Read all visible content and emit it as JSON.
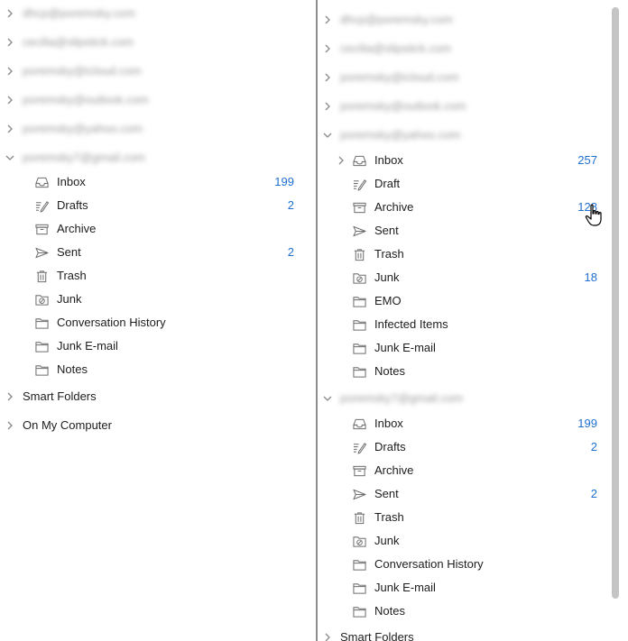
{
  "left": {
    "accounts": [
      {
        "label": "dhcp@poremsky.com",
        "expanded": false
      },
      {
        "label": "cecilia@slipstick.com",
        "expanded": false
      },
      {
        "label": "poremsky@icloud.com",
        "expanded": false
      },
      {
        "label": "poremsky@outlook.com",
        "expanded": false
      },
      {
        "label": "poremsky@yahoo.com",
        "expanded": false
      },
      {
        "label": "poremsky7@gmail.com",
        "expanded": true
      }
    ],
    "folders": [
      {
        "name": "Inbox",
        "icon": "inbox-icon",
        "count": "199"
      },
      {
        "name": "Drafts",
        "icon": "drafts-icon",
        "count": "2"
      },
      {
        "name": "Archive",
        "icon": "archive-icon",
        "count": ""
      },
      {
        "name": "Sent",
        "icon": "sent-icon",
        "count": "2"
      },
      {
        "name": "Trash",
        "icon": "trash-icon",
        "count": ""
      },
      {
        "name": "Junk",
        "icon": "junk-icon",
        "count": ""
      },
      {
        "name": "Conversation History",
        "icon": "folder-icon",
        "count": ""
      },
      {
        "name": "Junk E-mail",
        "icon": "folder-icon",
        "count": ""
      },
      {
        "name": "Notes",
        "icon": "folder-icon",
        "count": ""
      }
    ],
    "sections": [
      {
        "label": "Smart Folders"
      },
      {
        "label": "On My Computer"
      }
    ]
  },
  "right": {
    "accounts": [
      {
        "label": "dhcp@poremsky.com",
        "expanded": false
      },
      {
        "label": "cecilia@slipstick.com",
        "expanded": false
      },
      {
        "label": "poremsky@icloud.com",
        "expanded": false
      },
      {
        "label": "poremsky@outlook.com",
        "expanded": false
      }
    ],
    "yahoo_account": {
      "label": "poremsky@yahoo.com",
      "expanded": true
    },
    "yahoo_folders": [
      {
        "name": "Inbox",
        "icon": "inbox-icon",
        "count": "257",
        "has_children": true
      },
      {
        "name": "Draft",
        "icon": "drafts-icon",
        "count": ""
      },
      {
        "name": "Archive",
        "icon": "archive-icon",
        "count": "128"
      },
      {
        "name": "Sent",
        "icon": "sent-icon",
        "count": ""
      },
      {
        "name": "Trash",
        "icon": "trash-icon",
        "count": ""
      },
      {
        "name": "Junk",
        "icon": "junk-icon",
        "count": "18"
      },
      {
        "name": "EMO",
        "icon": "folder-icon",
        "count": ""
      },
      {
        "name": "Infected Items",
        "icon": "folder-icon",
        "count": ""
      },
      {
        "name": "Junk E-mail",
        "icon": "folder-icon",
        "count": ""
      },
      {
        "name": "Notes",
        "icon": "folder-icon",
        "count": ""
      }
    ],
    "gmail_account": {
      "label": "poremsky7@gmail.com",
      "expanded": true
    },
    "gmail_folders": [
      {
        "name": "Inbox",
        "icon": "inbox-icon",
        "count": "199"
      },
      {
        "name": "Drafts",
        "icon": "drafts-icon",
        "count": "2"
      },
      {
        "name": "Archive",
        "icon": "archive-icon",
        "count": ""
      },
      {
        "name": "Sent",
        "icon": "sent-icon",
        "count": "2"
      },
      {
        "name": "Trash",
        "icon": "trash-icon",
        "count": ""
      },
      {
        "name": "Junk",
        "icon": "junk-icon",
        "count": ""
      },
      {
        "name": "Conversation History",
        "icon": "folder-icon",
        "count": ""
      },
      {
        "name": "Junk E-mail",
        "icon": "folder-icon",
        "count": ""
      },
      {
        "name": "Notes",
        "icon": "folder-icon",
        "count": ""
      }
    ],
    "sections": [
      {
        "label": "Smart Folders"
      }
    ]
  },
  "colors": {
    "count_blue": "#1f6fd1",
    "icon_gray": "#6f6f6f",
    "divider": "#8e8e8e"
  }
}
